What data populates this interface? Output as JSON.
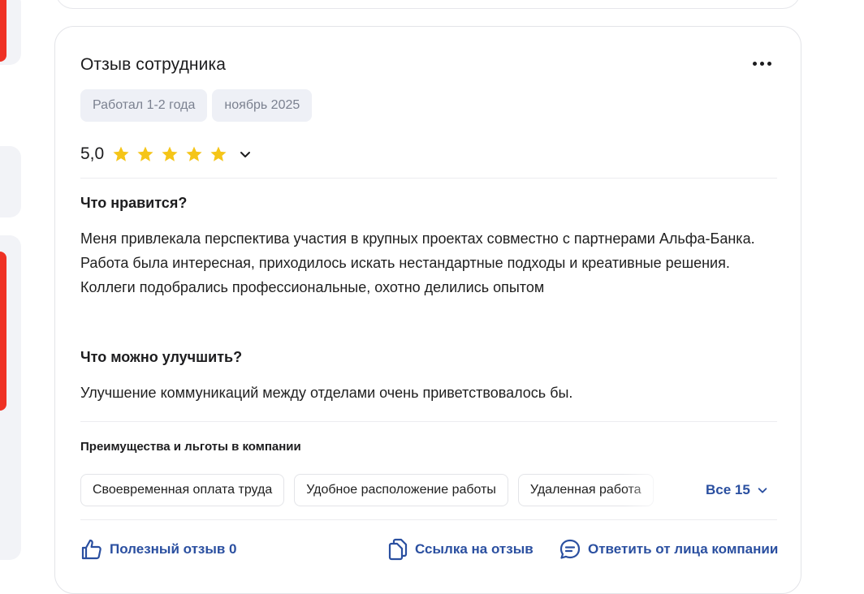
{
  "review": {
    "title": "Отзыв сотрудника",
    "tags": [
      "Работал 1-2 года",
      "ноябрь 2025"
    ],
    "rating": "5,0",
    "rating_value": 5,
    "rating_max": 5,
    "likes_heading": "Что нравится?",
    "likes_text": "Меня привлекала перспектива участия в крупных проектах совместно с партнерами Альфа-Банка. Работа была интересная, приходилось искать нестандартные подходы и креативные решения. Коллеги подобрались профессиональные, охотно делились опытом",
    "improve_heading": "Что можно улучшить?",
    "improve_text": "Улучшение коммуникаций между отделами очень приветствовалось бы.",
    "benefits_title": "Преимущества и льготы в компании",
    "benefits": [
      "Своевременная оплата труда",
      "Удобное расположение работы",
      "Удаленная работа"
    ],
    "benefits_all": "Все 15",
    "actions": {
      "helpful": "Полезный отзыв 0",
      "link": "Ссылка на отзыв",
      "reply": "Ответить от лица компании"
    }
  },
  "colors": {
    "accent": "#2a4fa0",
    "star": "#f5c518",
    "brand_red": "#ef3124",
    "tag_bg": "#eef0f6"
  },
  "icons": [
    "more-icon",
    "star-icon",
    "chevron-down-icon",
    "thumbs-up-icon",
    "copy-link-icon",
    "chat-bubble-icon"
  ]
}
